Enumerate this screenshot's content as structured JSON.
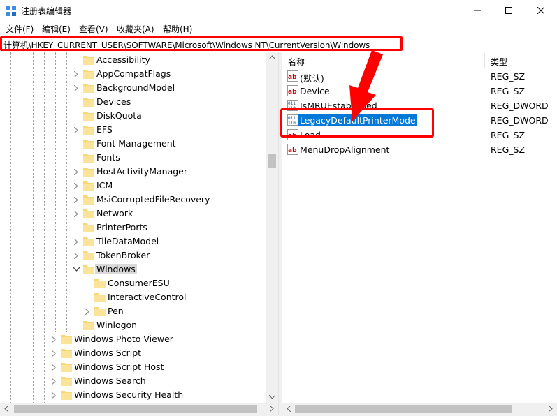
{
  "window": {
    "title": "注册表编辑器",
    "minimize": "—",
    "maximize": "☐",
    "close": "✕"
  },
  "menu": [
    "文件(F)",
    "编辑(E)",
    "查看(V)",
    "收藏夹(A)",
    "帮助(H)"
  ],
  "address": "计算机\\HKEY_CURRENT_USER\\SOFTWARE\\Microsoft\\Windows NT\\CurrentVersion\\Windows",
  "tree": [
    {
      "label": "Accessibility",
      "expandable": false
    },
    {
      "label": "AppCompatFlags",
      "expandable": true
    },
    {
      "label": "BackgroundModel",
      "expandable": true
    },
    {
      "label": "Devices",
      "expandable": false
    },
    {
      "label": "DiskQuota",
      "expandable": false
    },
    {
      "label": "EFS",
      "expandable": true
    },
    {
      "label": "Font Management",
      "expandable": false
    },
    {
      "label": "Fonts",
      "expandable": false
    },
    {
      "label": "HostActivityManager",
      "expandable": true
    },
    {
      "label": "ICM",
      "expandable": true
    },
    {
      "label": "MsiCorruptedFileRecovery",
      "expandable": true
    },
    {
      "label": "Network",
      "expandable": true
    },
    {
      "label": "PrinterPorts",
      "expandable": false
    },
    {
      "label": "TileDataModel",
      "expandable": true
    },
    {
      "label": "TokenBroker",
      "expandable": true
    },
    {
      "label": "Windows",
      "expandable": true,
      "expanded": true,
      "selected": true
    },
    {
      "label": "ConsumerESU",
      "expandable": false,
      "child": true
    },
    {
      "label": "InteractiveControl",
      "expandable": false,
      "child": true
    },
    {
      "label": "Pen",
      "expandable": true,
      "child": true
    },
    {
      "label": "Winlogon",
      "expandable": false
    },
    {
      "label": "Windows Photo Viewer",
      "expandable": true,
      "upper": true
    },
    {
      "label": "Windows Script",
      "expandable": true,
      "upper": true
    },
    {
      "label": "Windows Script Host",
      "expandable": true,
      "upper": true
    },
    {
      "label": "Windows Search",
      "expandable": true,
      "upper": true
    },
    {
      "label": "Windows Security Health",
      "expandable": true,
      "upper": true
    }
  ],
  "columns": {
    "name": "名称",
    "type": "类型"
  },
  "values": [
    {
      "name": "(默认)",
      "type": "REG_SZ",
      "icon": "string-value-icon"
    },
    {
      "name": "Device",
      "type": "REG_SZ",
      "icon": "string-value-icon"
    },
    {
      "name": "IsMRUEstablished",
      "type": "REG_DWORD",
      "icon": "binary-value-icon"
    },
    {
      "name": "LegacyDefaultPrinterMode",
      "type": "REG_DWORD",
      "icon": "binary-value-icon",
      "selected": true
    },
    {
      "name": "Load",
      "type": "REG_SZ",
      "icon": "string-value-icon"
    },
    {
      "name": "MenuDropAlignment",
      "type": "REG_SZ",
      "icon": "string-value-icon"
    }
  ],
  "colors": {
    "accent": "#0078d7",
    "annotation": "#ff0000",
    "folder": "#f8d775"
  }
}
